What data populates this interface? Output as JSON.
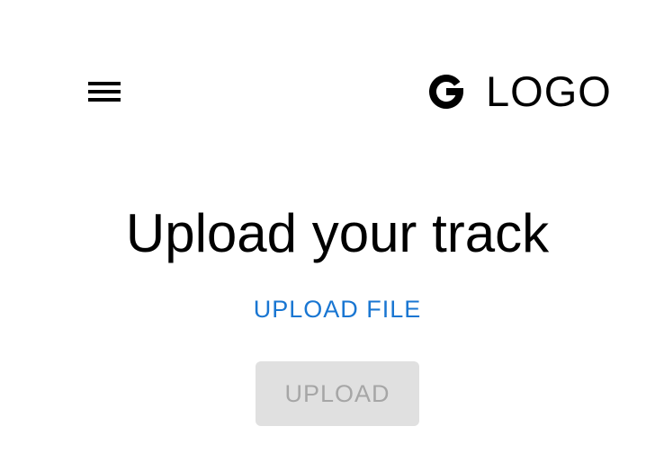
{
  "header": {
    "menu_icon": "hamburger-menu-icon",
    "brand_icon": "google-g-icon",
    "logo_text": "LOGO"
  },
  "main": {
    "title": "Upload your track",
    "upload_file_label": "UPLOAD FILE",
    "upload_button_label": "UPLOAD",
    "upload_button_disabled": true
  },
  "colors": {
    "link": "#1976d2",
    "disabled_bg": "#e0e0e0",
    "disabled_text": "#a6a6a6",
    "text": "#000000",
    "background": "#ffffff"
  }
}
